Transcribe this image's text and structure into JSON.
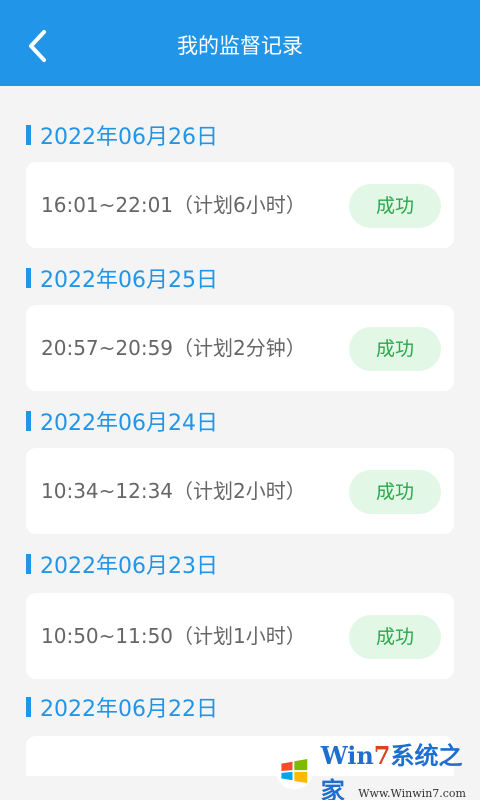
{
  "header": {
    "title": "我的监督记录",
    "back_icon": "chevron-left-icon",
    "bg_color": "#2196e8"
  },
  "records": [
    {
      "date": "2022年06月26日",
      "time": "16:01~22:01（计划6小时）",
      "status": "成功"
    },
    {
      "date": "2022年06月25日",
      "time": "20:57~20:59（计划2分钟）",
      "status": "成功"
    },
    {
      "date": "2022年06月24日",
      "time": "10:34~12:34（计划2小时）",
      "status": "成功"
    },
    {
      "date": "2022年06月23日",
      "time": "10:50~11:50（计划1小时）",
      "status": "成功"
    },
    {
      "date": "2022年06月22日",
      "time": "",
      "status": ""
    }
  ],
  "watermark": {
    "brand_part1": "Win",
    "brand_part2": "7",
    "brand_part3": "系统之家",
    "url": "Www.Winwin7.com"
  },
  "colors": {
    "accent": "#2196e8",
    "success_text": "#2aa84a",
    "success_bg": "#e3f7e6"
  }
}
